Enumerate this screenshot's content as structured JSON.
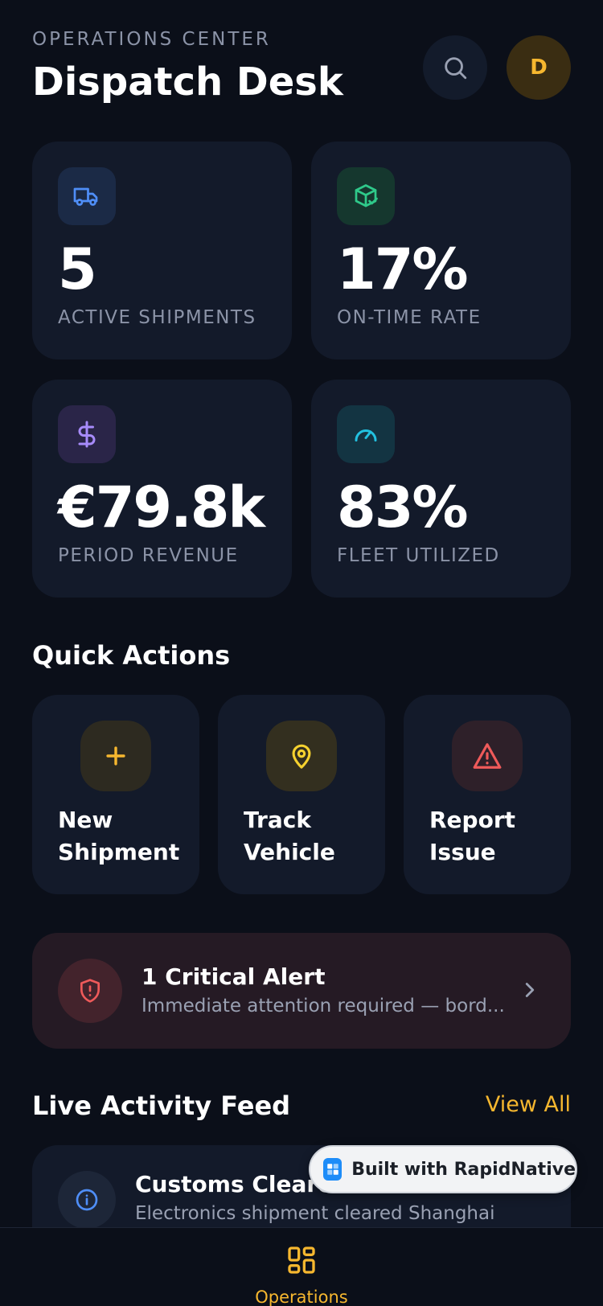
{
  "header": {
    "eyebrow": "OPERATIONS CENTER",
    "title": "Dispatch Desk",
    "avatar_initial": "D"
  },
  "stats": [
    {
      "value": "5",
      "label": "ACTIVE SHIPMENTS",
      "icon": "truck-icon",
      "color": "#3b82f6"
    },
    {
      "value": "17%",
      "label": "ON-TIME RATE",
      "icon": "package-check-icon",
      "color": "#22c55e"
    },
    {
      "value": "€79.8k",
      "label": "PERIOD REVENUE",
      "icon": "dollar-icon",
      "color": "#8b5cf6"
    },
    {
      "value": "83%",
      "label": "FLEET UTILIZED",
      "icon": "gauge-icon",
      "color": "#06b6d4"
    }
  ],
  "quick_actions": {
    "title": "Quick Actions",
    "items": [
      {
        "label": "New Shipment",
        "icon": "plus-icon",
        "color": "#f6b72f"
      },
      {
        "label": "Track Vehicle",
        "icon": "map-pin-icon",
        "color": "#f6d22f"
      },
      {
        "label": "Report Issue",
        "icon": "warning-icon",
        "color": "#ef5a5a"
      }
    ]
  },
  "alert": {
    "title": "1 Critical Alert",
    "subtitle": "Immediate attention required — bord..."
  },
  "activity": {
    "title": "Live Activity Feed",
    "view_all": "View All",
    "items": [
      {
        "title": "Customs Cleared",
        "subtitle": "Electronics shipment cleared Shanghai"
      }
    ]
  },
  "badge": {
    "text": "Built with RapidNative"
  },
  "nav": {
    "active_label": "Operations"
  },
  "colors": {
    "accent": "#f6b72f",
    "background": "#0b0f19",
    "card": "#131a2a"
  }
}
